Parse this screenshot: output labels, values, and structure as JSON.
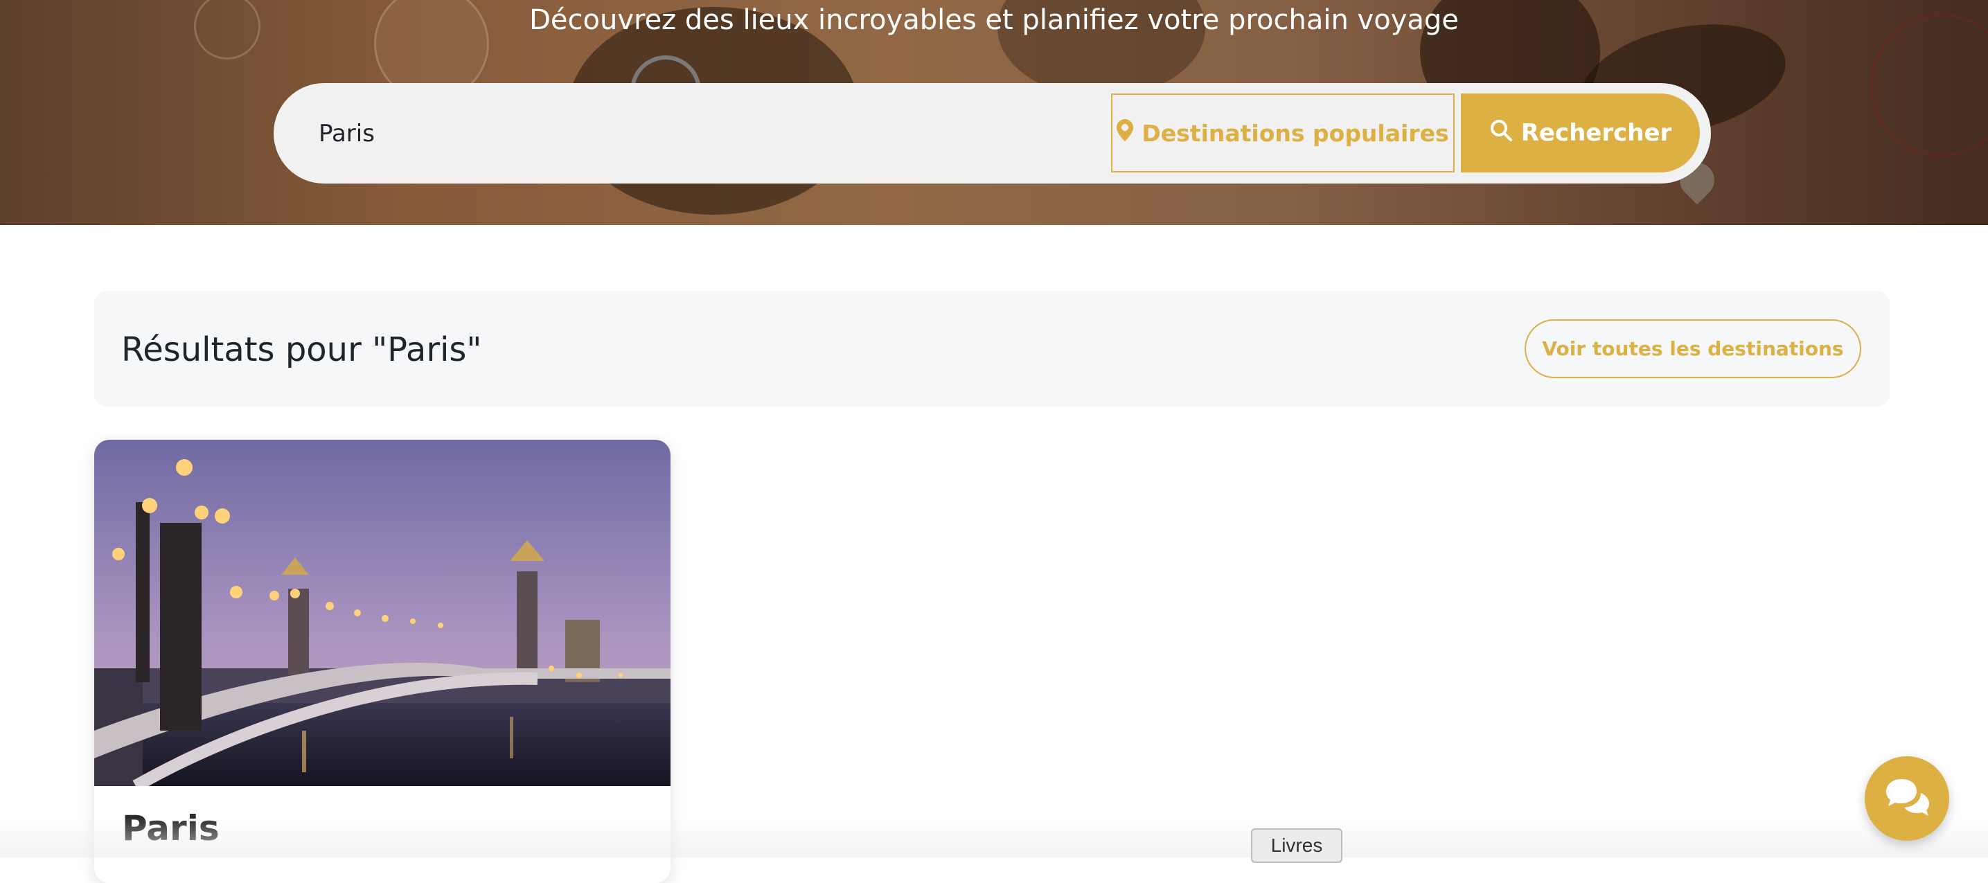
{
  "hero": {
    "tagline": "Découvrez des lieux incroyables et planifiez votre prochain voyage"
  },
  "search": {
    "value": "Paris",
    "popular_label": "Destinations populaires",
    "popular_icon": "map-marker-icon",
    "submit_label": "Rechercher",
    "submit_icon": "search-icon"
  },
  "results": {
    "title": "Résultats pour \"Paris\"",
    "view_all_label": "Voir toutes les destinations",
    "cards": [
      {
        "title": "Paris",
        "image": "paris-bridge-dusk"
      }
    ]
  },
  "footer": {
    "books_tab": "Livres"
  },
  "chat": {
    "icon": "chat-bubbles-icon"
  },
  "colors": {
    "accent": "#ddb043",
    "white": "#ffffff",
    "panel": "#f6f7f9",
    "search_bg": "#f1f1f1"
  }
}
